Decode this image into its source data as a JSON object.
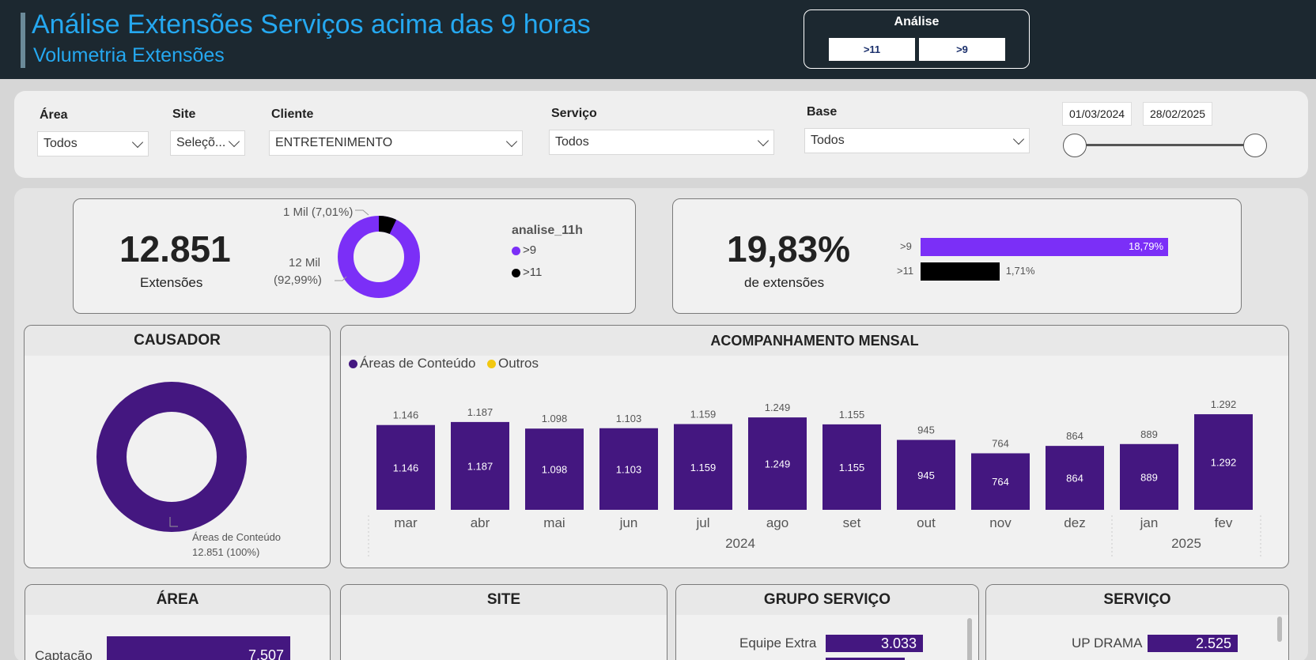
{
  "header": {
    "title": "Análise Extensões Serviços acima das 9 horas",
    "subtitle": "Volumetria Extensões",
    "analise": {
      "label": "Análise",
      "options": [
        ">11",
        ">9"
      ]
    }
  },
  "filters": {
    "area": {
      "label": "Área",
      "value": "Todos"
    },
    "site": {
      "label": "Site",
      "value": "Seleçõ..."
    },
    "cliente": {
      "label": "Cliente",
      "value": "ENTRETENIMENTO"
    },
    "servico": {
      "label": "Serviço",
      "value": "Todos"
    },
    "base": {
      "label": "Base",
      "value": "Todos"
    },
    "date_start": "01/03/2024",
    "date_end": "28/02/2025"
  },
  "kpi1": {
    "value": "12.851",
    "label": "Extensões",
    "donut_label_small": "1 Mil (7,01%)",
    "donut_label_big_1": "12 Mil",
    "donut_label_big_2": "(92,99%)",
    "legend_title": "analise_11h",
    "legend": [
      {
        "name": ">9",
        "color": "#7b2ff7"
      },
      {
        "name": ">11",
        "color": "#000000"
      }
    ],
    "shares": [
      92.99,
      7.01
    ]
  },
  "kpi2": {
    "value": "19,83%",
    "label": "de extensões",
    "bars": [
      {
        "name": ">9",
        "value": 18.79,
        "label": "18,79%",
        "color": "#7b2ff7"
      },
      {
        "name": ">11",
        "value": 1.71,
        "label": "1,71%",
        "color": "#000000"
      }
    ]
  },
  "causador": {
    "title": "CAUSADOR",
    "label_1": "Áreas de Conteúdo",
    "label_2": "12.851 (100%)"
  },
  "monthly": {
    "title": "ACOMPANHAMENTO MENSAL",
    "legend": [
      {
        "name": "Áreas de Conteúdo",
        "color": "#441780"
      },
      {
        "name": "Outros",
        "color": "#f2c811"
      }
    ],
    "years": [
      "2024",
      "2025"
    ]
  },
  "area": {
    "title": "ÁREA",
    "items": [
      {
        "label": "Captação",
        "value": "7.507"
      }
    ]
  },
  "site": {
    "title": "SITE"
  },
  "grupo_servico": {
    "title": "GRUPO SERVIÇO",
    "items": [
      {
        "label": "Equipe Extra",
        "value": "3.033"
      }
    ]
  },
  "servico": {
    "title": "SERVIÇO",
    "items": [
      {
        "label": "UP DRAMA",
        "value": "2.525"
      }
    ]
  },
  "chart_data": {
    "type": "bar",
    "title": "ACOMPANHAMENTO MENSAL",
    "categories": [
      "mar",
      "abr",
      "mai",
      "jun",
      "jul",
      "ago",
      "set",
      "out",
      "nov",
      "dez",
      "jan",
      "fev"
    ],
    "year_groups": [
      {
        "year": "2024",
        "months": 10
      },
      {
        "year": "2025",
        "months": 2
      }
    ],
    "series": [
      {
        "name": "Áreas de Conteúdo",
        "values": [
          1146,
          1187,
          1098,
          1103,
          1159,
          1249,
          1155,
          945,
          764,
          864,
          889,
          1292
        ]
      }
    ],
    "value_labels": [
      "1.146",
      "1.187",
      "1.098",
      "1.103",
      "1.159",
      "1.249",
      "1.155",
      "945",
      "764",
      "864",
      "889",
      "1.292"
    ],
    "legend_position": "top-left"
  }
}
